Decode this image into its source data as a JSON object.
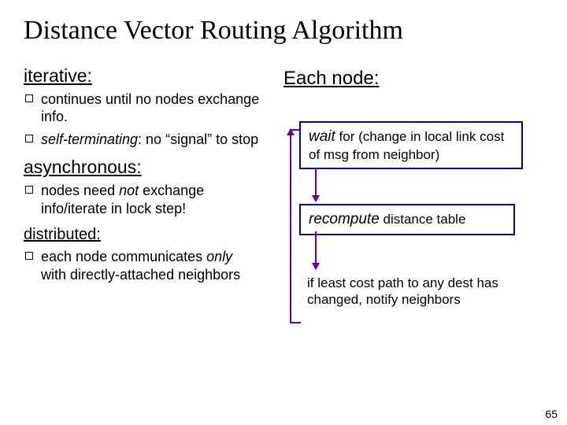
{
  "title": "Distance Vector Routing Algorithm",
  "left": {
    "iterative": {
      "heading": "iterative:",
      "b1a": "continues until no nodes exchange info.",
      "b2a": "self-terminating",
      "b2b": ": no “signal” to stop"
    },
    "async": {
      "heading": "asynchronous:",
      "b1a": "nodes need ",
      "b1b": "not",
      "b1c": " exchange info/iterate in lock step!"
    },
    "dist": {
      "heading": "distributed:",
      "b1a": "each node communicates ",
      "b1b": "only",
      "b1c": " with directly-attached neighbors"
    }
  },
  "right": {
    "heading": "Each node:",
    "box1a": "wait",
    "box1b": " for (change in local link cost of msg from neighbor)",
    "box2a": "recompute",
    "box2b": " distance table",
    "box3a": "if least cost path to any dest has changed, ",
    "box3b": "notify",
    "box3c": " neighbors"
  },
  "page": "65"
}
